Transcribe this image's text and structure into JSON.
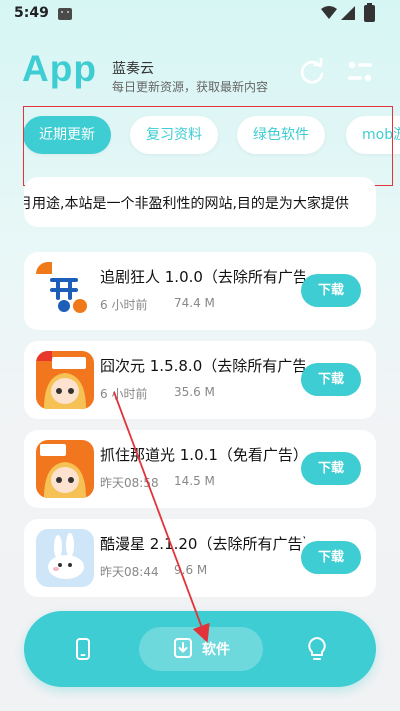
{
  "status": {
    "time": "5:49"
  },
  "header": {
    "logo": "App",
    "name": "蓝奏云",
    "description": "每日更新资源，获取最新内容"
  },
  "tabs": [
    {
      "label": "近期更新",
      "active": true
    },
    {
      "label": "复习资料",
      "active": false
    },
    {
      "label": "绿色软件",
      "active": false
    },
    {
      "label": "mob游",
      "active": false
    }
  ],
  "notice": "月用途,本站是一个非盈利性的网站,目的是为大家提供",
  "apps": [
    {
      "title": "追剧狂人 1.0.0（去除所有广告）",
      "time": "6 小时前",
      "size": "74.4 M",
      "button": "下载",
      "icon": "drama-app-icon"
    },
    {
      "title": "囧次元 1.5.8.0（去除所有广告）",
      "time": "6 小时前",
      "size": "35.6 M",
      "button": "下载",
      "icon": "anime-girl-icon"
    },
    {
      "title": "抓住那道光 1.0.1（免看广告）",
      "time": "昨天08:58",
      "size": "14.5 M",
      "button": "下载",
      "icon": "anime-girl-icon"
    },
    {
      "title": "酷漫星 2.1.20（去除所有广告）",
      "time": "昨天08:44",
      "size": "9.6 M",
      "button": "下载",
      "icon": "rabbit-icon"
    }
  ],
  "bottom_nav": {
    "items": [
      {
        "name": "phone",
        "icon": "phone-icon"
      },
      {
        "name": "software",
        "label": "软件",
        "icon": "download-icon",
        "active": true
      },
      {
        "name": "tips",
        "icon": "lightbulb-icon"
      }
    ]
  },
  "colors": {
    "accent": "#3ecdd2",
    "highlight": "#e2333b"
  }
}
